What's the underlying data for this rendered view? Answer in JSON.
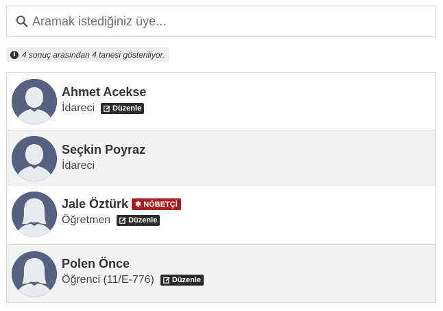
{
  "search": {
    "placeholder": "Aramak istediğiniz üye...",
    "value": ""
  },
  "result_count": "4 sonuç arasından 4 tanesi gösteriliyor.",
  "members": [
    {
      "name": "Ahmet Acekse",
      "role": "İdareci",
      "edit_label": "Düzenle",
      "gender": "male"
    },
    {
      "name": "Seçkin Poyraz",
      "role": "İdareci",
      "gender": "male"
    },
    {
      "name": "Jale Öztürk",
      "role": "Öğretmen",
      "edit_label": "Düzenle",
      "duty_label": "NÖBETÇİ",
      "gender": "female"
    },
    {
      "name": "Polen Önce",
      "role": "Öğrenci (11/E-776)",
      "edit_label": "Düzenle",
      "gender": "female"
    }
  ],
  "colors": {
    "avatar_bg": "#56627f",
    "badge_dark": "#2b2b2b",
    "badge_duty": "#a61e22"
  }
}
